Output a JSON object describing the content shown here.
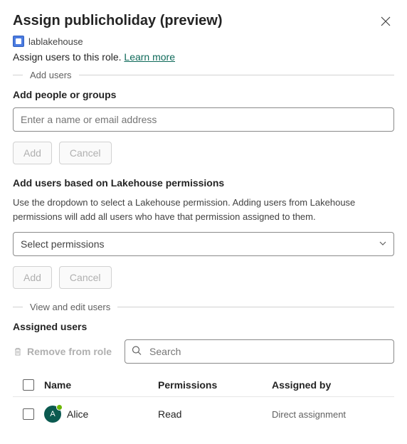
{
  "header": {
    "title": "Assign publicholiday (preview)"
  },
  "lakehouse": {
    "name": "lablakehouse"
  },
  "description": {
    "text": "Assign users to this role. ",
    "link": "Learn more"
  },
  "section_add": {
    "divider_label": "Add users",
    "people_title": "Add people or groups",
    "people_placeholder": "Enter a name or email address",
    "add_btn": "Add",
    "cancel_btn": "Cancel",
    "lakehouse_title": "Add users based on Lakehouse permissions",
    "lakehouse_help": "Use the dropdown to select a Lakehouse permission. Adding users from Lakehouse permissions will add all users who have that permission assigned to them.",
    "select_placeholder": "Select permissions"
  },
  "section_view": {
    "divider_label": "View and edit users",
    "title": "Assigned users",
    "remove_label": "Remove from role",
    "search_placeholder": "Search"
  },
  "table": {
    "columns": {
      "name": "Name",
      "permissions": "Permissions",
      "assigned_by": "Assigned by"
    },
    "rows": [
      {
        "avatar_initial": "A",
        "name": "Alice",
        "permission": "Read",
        "assigned_by": "Direct assignment"
      }
    ]
  }
}
